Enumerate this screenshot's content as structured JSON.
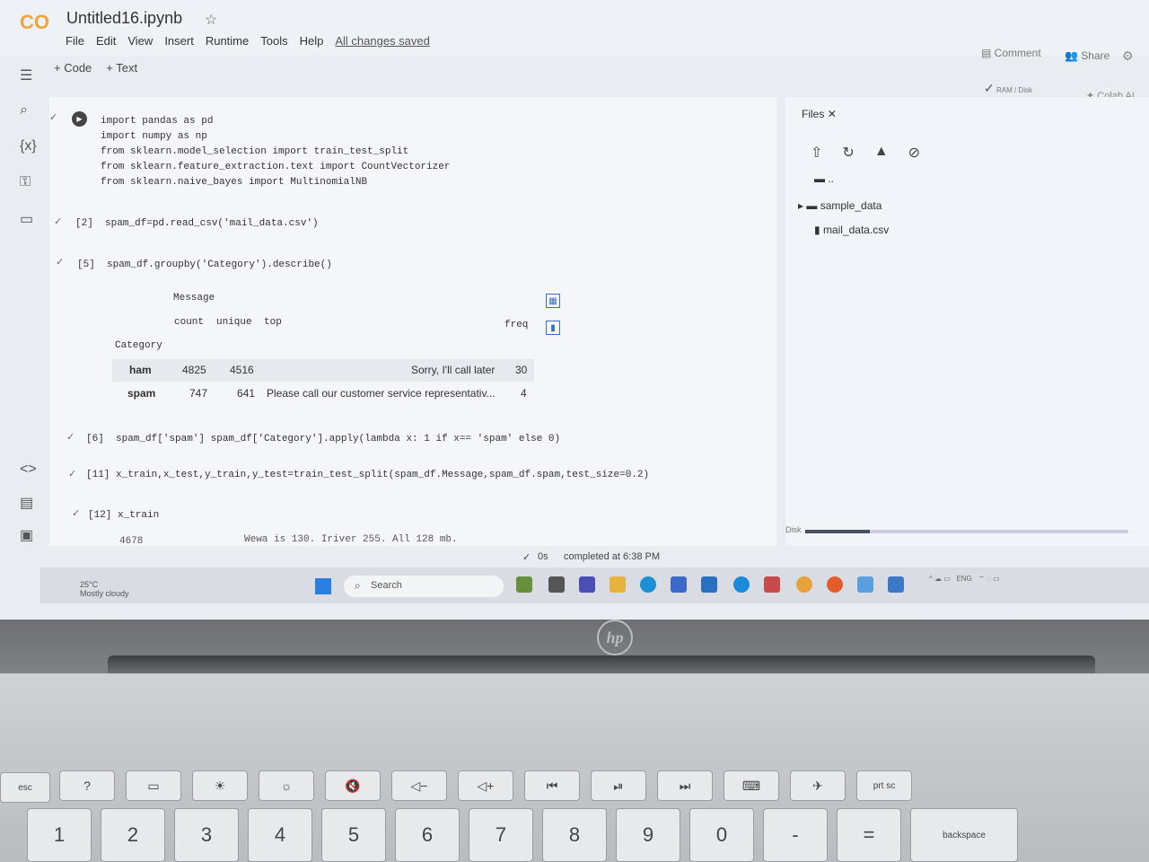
{
  "header": {
    "logo": "CO",
    "notebook_title": "Untitled16.ipynb",
    "menu": [
      "File",
      "Edit",
      "View",
      "Insert",
      "Runtime",
      "Tools",
      "Help"
    ],
    "save_status": "All changes saved",
    "comment_label": "Comment",
    "share_label": "Share",
    "ram_label": "RAM",
    "disk_label": "Disk",
    "colab_ai_label": "Colab AI"
  },
  "toolbar": {
    "code_label": "+ Code",
    "text_label": "+ Text"
  },
  "cells": {
    "c1_lines": [
      "import pandas as pd",
      "import numpy as np",
      "from sklearn.model_selection import train_test_split",
      "from sklearn.feature_extraction.text import CountVectorizer",
      "from sklearn.naive_bayes import MultinomialNB"
    ],
    "c2": "[2]  spam_df=pd.read_csv('mail_data.csv')",
    "c3": "[5]  spam_df.groupby('Category').describe()",
    "c4": "[6]  spam_df['spam'] spam_df['Category'].apply(lambda x: 1 if x== 'spam' else 0)",
    "c5": "[11] x_train,x_test,y_train,y_test=train_test_split(spam_df.Message,spam_df.spam,test_size=0.2)",
    "c6": "[12] x_train",
    "output_partial_index": "4678",
    "output_partial_text": "Wewa is 130. Iriver 255. All 128 mb."
  },
  "dataframe": {
    "group_header": "Message",
    "columns": [
      "count",
      "unique",
      "top",
      "freq"
    ],
    "index_name": "Category",
    "rows": [
      {
        "label": "ham",
        "count": "4825",
        "unique": "4516",
        "top": "Sorry, I'll call later",
        "freq": "30"
      },
      {
        "label": "spam",
        "count": "747",
        "unique": "641",
        "top": "Please call our customer service representativ...",
        "freq": "4"
      }
    ]
  },
  "files_panel": {
    "title": "Files",
    "parent": "..",
    "items": [
      "sample_data",
      "mail_data.csv"
    ],
    "disk_label": "Disk"
  },
  "status": {
    "time": "0s",
    "completed": "completed at 6:38 PM"
  },
  "taskbar": {
    "temperature": "25°C",
    "weather": "Mostly cloudy",
    "search_placeholder": "Search",
    "lang": "ENG"
  },
  "keyboard": {
    "fn_row": [
      "esc",
      "?",
      "",
      "",
      "",
      "",
      "",
      "",
      "",
      "",
      "",
      "",
      "",
      "",
      "prt sc"
    ],
    "num_row": [
      "1",
      "2",
      "3",
      "4",
      "5",
      "6",
      "7",
      "8",
      "9",
      "0",
      "-",
      "=",
      "backspace"
    ],
    "num_row_symbols": [
      "!",
      "@",
      "#",
      "$",
      "%",
      "^",
      "&",
      "*",
      "(",
      ")",
      "",
      "+",
      ""
    ]
  },
  "brand": "hp",
  "colors": {
    "accent": "#f2a33a",
    "link": "#3a6fbf"
  }
}
